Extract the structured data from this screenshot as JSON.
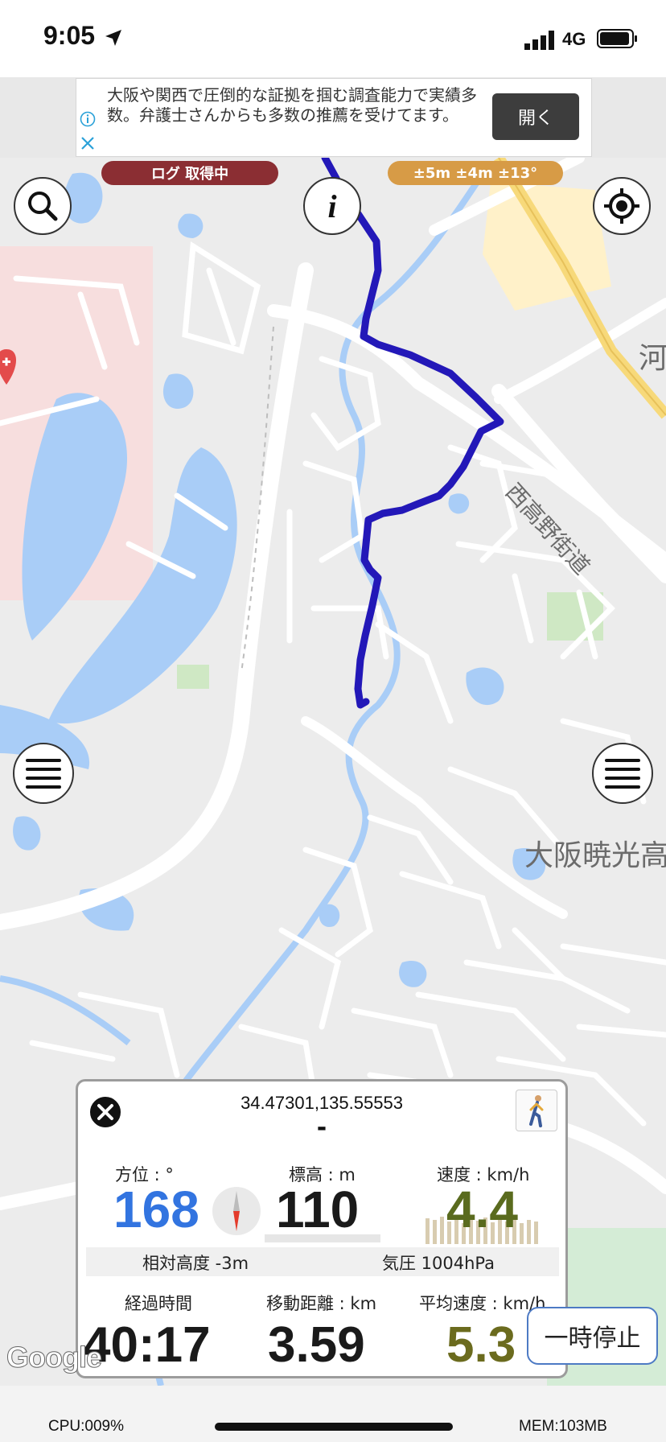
{
  "status_bar": {
    "time": "9:05",
    "network": "4G"
  },
  "ad": {
    "text": "大阪や関西で圧倒的な証拠を掴む調査能力で実績多数。弁護士さんからも多数の推薦を受けてます。",
    "open_label": "開く"
  },
  "map": {
    "log_status": "ログ 取得中",
    "accuracy": "±5m ±4m ±13°",
    "labels": {
      "road": "西高野街道",
      "area": "大阪暁光高",
      "kawa": "河"
    },
    "attribution": "Google"
  },
  "panel": {
    "coordinates": "34.47301,135.55553",
    "place": "-",
    "bearing_label": "方位 : °",
    "bearing_value": "168",
    "altitude_label": "標高 : m",
    "altitude_value": "110",
    "speed_label": "速度 : km/h",
    "speed_value": "4.4",
    "relative_altitude": "相対高度 -3m",
    "pressure": "気圧 1004hPa",
    "elapsed_label": "経過時間",
    "elapsed_value": "40:17",
    "distance_label": "移動距離 : km",
    "distance_value": "3.59",
    "avg_speed_label": "平均速度 : km/h",
    "avg_speed_value": "5.3"
  },
  "pause_label": "一時停止",
  "footer": {
    "cpu": "CPU:009%",
    "mem": "MEM:103MB"
  },
  "colors": {
    "route": "#2318b8",
    "water": "#a9cdf7",
    "bearing": "#3274e0",
    "speed": "#5a6b1e",
    "avg_speed": "#6b6b1e",
    "log_pill": "#8b2e33",
    "accuracy_pill": "#d79b46"
  },
  "icons": [
    "location-arrow-icon",
    "signal-icon",
    "battery-icon",
    "info-icon",
    "close-icon",
    "search-icon",
    "info-italic-icon",
    "target-icon",
    "menu-icon",
    "compass-icon",
    "walker-icon"
  ]
}
